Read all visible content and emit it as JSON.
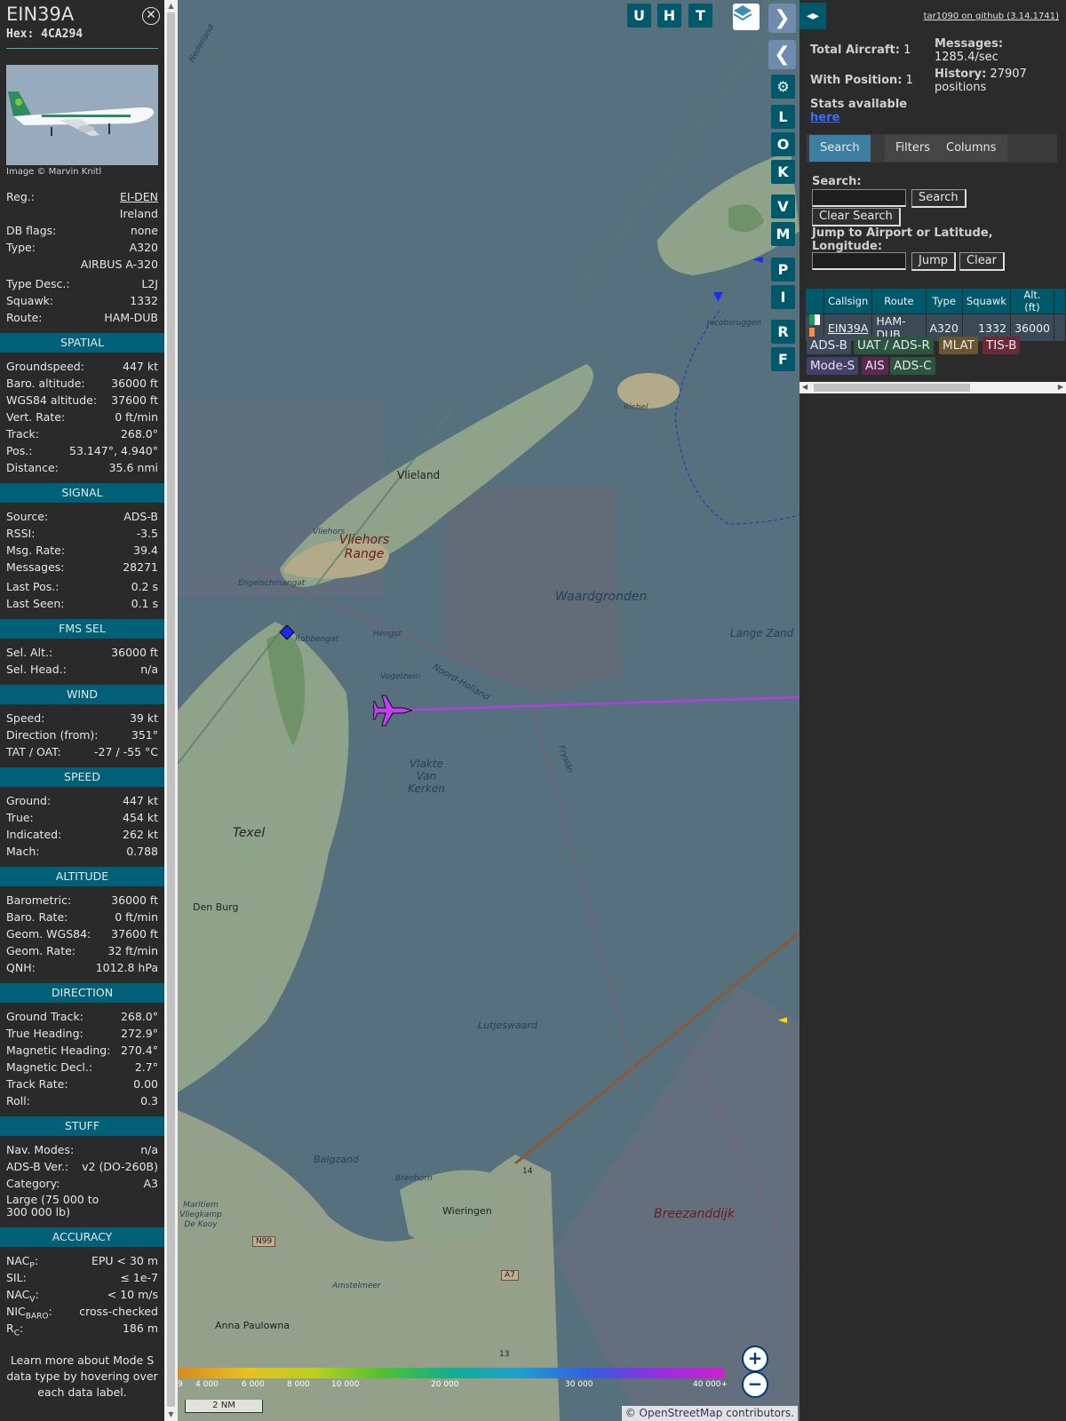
{
  "aircraft": {
    "callsign": "EIN39A",
    "hex_label": "Hex:",
    "hex": "4CA294",
    "photo_credit": "Image © Marvin Knitl",
    "reg_label": "Reg.:",
    "reg": "EI-DEN",
    "country": "Ireland",
    "dbflags_label": "DB flags:",
    "dbflags": "none",
    "type_label": "Type:",
    "type": "A320",
    "type_name": "AIRBUS A-320",
    "typedesc_label": "Type Desc.:",
    "typedesc": "L2J",
    "squawk_label": "Squawk:",
    "squawk": "1332",
    "route_label": "Route:",
    "route": "HAM-DUB"
  },
  "spatial": {
    "title": "SPATIAL",
    "rows": [
      {
        "label": "Groundspeed:",
        "value": "447 kt"
      },
      {
        "label": "Baro. altitude:",
        "value": "36000 ft"
      },
      {
        "label": "WGS84 altitude:",
        "value": "37600 ft"
      },
      {
        "label": "Vert. Rate:",
        "value": "0 ft/min"
      },
      {
        "label": "Track:",
        "value": "268.0°"
      },
      {
        "label": "Pos.:",
        "value": "53.147°, 4.940°"
      },
      {
        "label": "Distance:",
        "value": "35.6 nmi"
      }
    ]
  },
  "signal": {
    "title": "SIGNAL",
    "rows": [
      {
        "label": "Source:",
        "value": "ADS-B"
      },
      {
        "label": "RSSI:",
        "value": "-3.5"
      },
      {
        "label": "Msg. Rate:",
        "value": "39.4"
      },
      {
        "label": "Messages:",
        "value": "28271"
      },
      {
        "label": "Last Pos.:",
        "value": "0.2 s"
      },
      {
        "label": "Last Seen:",
        "value": "0.1 s"
      }
    ]
  },
  "fms": {
    "title": "FMS SEL",
    "rows": [
      {
        "label": "Sel. Alt.:",
        "value": "36000 ft"
      },
      {
        "label": "Sel. Head.:",
        "value": "n/a"
      }
    ]
  },
  "wind": {
    "title": "WIND",
    "rows": [
      {
        "label": "Speed:",
        "value": "39 kt"
      },
      {
        "label": "Direction (from):",
        "value": "351°"
      },
      {
        "label": "TAT / OAT:",
        "value": "-27 / -55 °C"
      }
    ]
  },
  "speed": {
    "title": "SPEED",
    "rows": [
      {
        "label": "Ground:",
        "value": "447 kt"
      },
      {
        "label": "True:",
        "value": "454 kt"
      },
      {
        "label": "Indicated:",
        "value": "262 kt"
      },
      {
        "label": "Mach:",
        "value": "0.788"
      }
    ]
  },
  "altitude": {
    "title": "ALTITUDE",
    "rows": [
      {
        "label": "Barometric:",
        "value": "36000 ft"
      },
      {
        "label": "Baro. Rate:",
        "value": "0 ft/min"
      },
      {
        "label": "Geom. WGS84:",
        "value": "37600 ft"
      },
      {
        "label": "Geom. Rate:",
        "value": "32 ft/min"
      },
      {
        "label": "QNH:",
        "value": "1012.8 hPa"
      }
    ]
  },
  "direction": {
    "title": "DIRECTION",
    "rows": [
      {
        "label": "Ground Track:",
        "value": "268.0°"
      },
      {
        "label": "True Heading:",
        "value": "272.9°"
      },
      {
        "label": "Magnetic Heading:",
        "value": "270.4°"
      },
      {
        "label": "Magnetic Decl.:",
        "value": "2.7°"
      },
      {
        "label": "Track Rate:",
        "value": "0.00"
      },
      {
        "label": "Roll:",
        "value": "0.3"
      }
    ]
  },
  "stuff": {
    "title": "STUFF",
    "rows": [
      {
        "label": "Nav. Modes:",
        "value": "n/a"
      },
      {
        "label": "ADS-B Ver.:",
        "value": "v2 (DO-260B)"
      },
      {
        "label": "Category:",
        "value": "A3"
      }
    ],
    "category_desc": "Large (75 000 to 300 000 lb)"
  },
  "accuracy": {
    "title": "ACCURACY",
    "nacp_label": "NAC",
    "nacp_sub": "P",
    "nacp": "EPU < 30 m",
    "sil_label": "SIL:",
    "sil": "≤ 1e-7",
    "nacv_label": "NAC",
    "nacv_sub": "V",
    "nacv": "< 10 m/s",
    "nicbaro_label": "NIC",
    "nicbaro_sub": "BARO",
    "nicbaro": "cross-checked",
    "rc_label": "R",
    "rc_sub": "C",
    "rc": "186 m"
  },
  "learn_more": "Learn more about Mode S data type by hovering over each data label.",
  "map": {
    "buttons_top": [
      "U",
      "H",
      "T"
    ],
    "buttons_side": [
      "L",
      "O",
      "K",
      "V",
      "M",
      "P",
      "I",
      "R",
      "F"
    ],
    "labels": {
      "vlieland": "Vlieland",
      "vliehors": "Vliehors",
      "vliehors_range": "Vliehors Range",
      "waardgronden": "Waardgronden",
      "lange_zand": "Lange Zand",
      "richel": "Richel",
      "jacobsruggen": "Jacobsruggen",
      "engelschmangat": "Engelschmangat",
      "robbengat": "Robbengat",
      "hengst": "Hengst",
      "vogelzwin": "Vogelzwin",
      "noord_holland": "Noord-Holland",
      "vlakte": "Vlakte Van Kerken",
      "texel": "Texel",
      "den_burg": "Den Burg",
      "lutjeswaard": "Lutjeswaard",
      "balgzand": "Balgzand",
      "breehorn": "Breehorn",
      "wieringen": "Wieringen",
      "breezanddijk": "Breezanddijk",
      "maritiem": "Maritiem Vliegkamp De Kooy",
      "amstelmeer": "Amstelmeer",
      "anna_paulowna": "Anna Paulowna",
      "nederland": "Nederland",
      "fryslan": "Fryslân",
      "n99": "N99",
      "a7": "A7",
      "r14": "14",
      "r13": "13"
    },
    "color_scale": [
      "4 000",
      "6 000",
      "8 000",
      "10 000",
      "20 000",
      "30 000",
      "40 000+"
    ],
    "scale": "2 NM",
    "attribution_prefix": "©",
    "attribution_link": "OpenStreetMap",
    "attribution_suffix": "contributors."
  },
  "right": {
    "github": "tar1090 on github (3.14.1741)",
    "total_aircraft_label": "Total Aircraft:",
    "total_aircraft": "1",
    "with_position_label": "With Position:",
    "with_position": "1",
    "stats_label": "Stats available",
    "stats_link": "here",
    "messages_label": "Messages:",
    "messages": "1285.4/sec",
    "history_label": "History:",
    "history_value": "27907",
    "history_unit": "positions",
    "tabs": [
      "Search",
      "Filters",
      "Columns"
    ],
    "search_label": "Search:",
    "search_button": "Search",
    "clear_search_button": "Clear Search",
    "jump_label": "Jump to Airport or Latitude, Longitude:",
    "jump_button": "Jump",
    "clear_button": "Clear",
    "table_headers": [
      "Callsign",
      "Route",
      "Type",
      "Squawk",
      "Alt. (ft)"
    ],
    "table_row": {
      "callsign": "EIN39A",
      "route": "HAM-DUB",
      "type": "A320",
      "squawk": "1332",
      "alt": "36000"
    },
    "source_chips": [
      "ADS-B",
      "UAT / ADS-R",
      "MLAT",
      "TIS-B",
      "Mode-S",
      "AIS",
      "ADS-C"
    ]
  },
  "colors": {
    "section_header": "#006078",
    "map_button": "#00596b",
    "aircraft_marker": "#c040f0",
    "track_line": "#b040e0"
  }
}
